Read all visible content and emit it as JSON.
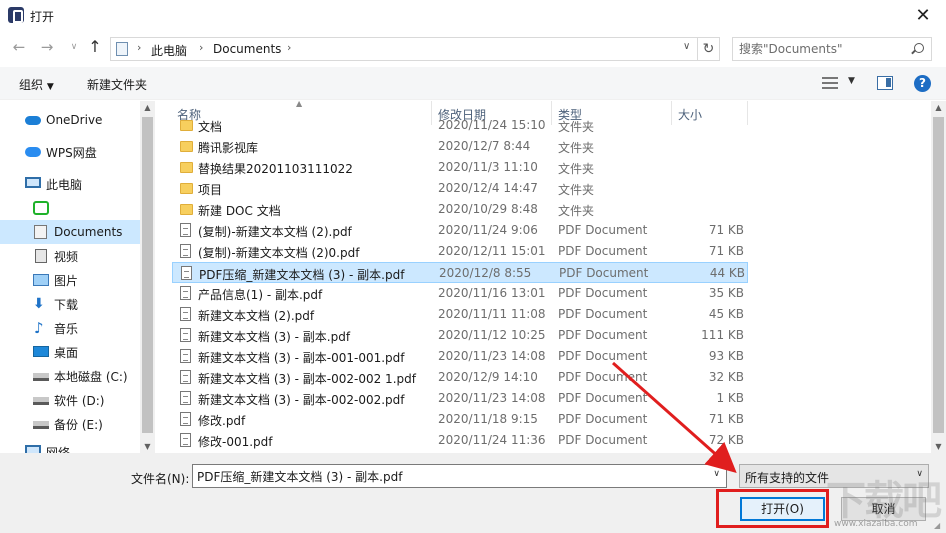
{
  "window": {
    "title": "打开",
    "close_label": "✕"
  },
  "nav": {
    "back_icon": "arrow-left-icon",
    "forward_icon": "arrow-right-icon",
    "up_icon": "arrow-up-icon",
    "address_segments": [
      "此电脑",
      "Documents"
    ],
    "search_placeholder": "搜索\"Documents\""
  },
  "toolbar": {
    "organize_label": "组织",
    "new_folder_label": "新建文件夹"
  },
  "sidebar": {
    "items": [
      {
        "label": "OneDrive",
        "icon": "cloud-icon"
      },
      {
        "label": "WPS网盘",
        "icon": "wps-cloud-icon"
      },
      {
        "label": "此电脑",
        "icon": "computer-icon"
      },
      {
        "label": "",
        "icon": "green-app-icon"
      },
      {
        "label": "Documents",
        "icon": "documents-icon",
        "selected": true
      },
      {
        "label": "视频",
        "icon": "video-icon"
      },
      {
        "label": "图片",
        "icon": "pictures-icon"
      },
      {
        "label": "下载",
        "icon": "download-icon"
      },
      {
        "label": "音乐",
        "icon": "music-icon"
      },
      {
        "label": "桌面",
        "icon": "desktop-icon"
      },
      {
        "label": "本地磁盘 (C:)",
        "icon": "drive-icon"
      },
      {
        "label": "软件 (D:)",
        "icon": "drive-icon"
      },
      {
        "label": "备份 (E:)",
        "icon": "drive-icon"
      },
      {
        "label": "网络",
        "icon": "network-icon"
      }
    ]
  },
  "filelist": {
    "columns": {
      "name": "名称",
      "date": "修改日期",
      "type": "类型",
      "size": "大小"
    },
    "rows": [
      {
        "name": "文档",
        "date": "2020/11/24 15:10",
        "type": "文件夹",
        "size": "",
        "kind": "folder"
      },
      {
        "name": "腾讯影视库",
        "date": "2020/12/7 8:44",
        "type": "文件夹",
        "size": "",
        "kind": "folder"
      },
      {
        "name": "替换结果20201103111022",
        "date": "2020/11/3 11:10",
        "type": "文件夹",
        "size": "",
        "kind": "folder"
      },
      {
        "name": "项目",
        "date": "2020/12/4 14:47",
        "type": "文件夹",
        "size": "",
        "kind": "folder"
      },
      {
        "name": "新建 DOC 文档",
        "date": "2020/10/29 8:48",
        "type": "文件夹",
        "size": "",
        "kind": "folder"
      },
      {
        "name": "(复制)-新建文本文档 (2).pdf",
        "date": "2020/11/24 9:06",
        "type": "PDF Document",
        "size": "71 KB",
        "kind": "file"
      },
      {
        "name": "(复制)-新建文本文档 (2)0.pdf",
        "date": "2020/12/11 15:01",
        "type": "PDF Document",
        "size": "71 KB",
        "kind": "file"
      },
      {
        "name": "PDF压缩_新建文本文档 (3) - 副本.pdf",
        "date": "2020/12/8 8:55",
        "type": "PDF Document",
        "size": "44 KB",
        "kind": "file",
        "selected": true
      },
      {
        "name": "产品信息(1) - 副本.pdf",
        "date": "2020/11/16 13:01",
        "type": "PDF Document",
        "size": "35 KB",
        "kind": "file"
      },
      {
        "name": "新建文本文档 (2).pdf",
        "date": "2020/11/11 11:08",
        "type": "PDF Document",
        "size": "45 KB",
        "kind": "file"
      },
      {
        "name": "新建文本文档 (3) - 副本.pdf",
        "date": "2020/11/12 10:25",
        "type": "PDF Document",
        "size": "111 KB",
        "kind": "file"
      },
      {
        "name": "新建文本文档 (3) - 副本-001-001.pdf",
        "date": "2020/11/23 14:08",
        "type": "PDF Document",
        "size": "93 KB",
        "kind": "file"
      },
      {
        "name": "新建文本文档 (3) - 副本-002-002 1.pdf",
        "date": "2020/12/9 14:10",
        "type": "PDF Document",
        "size": "32 KB",
        "kind": "file"
      },
      {
        "name": "新建文本文档 (3) - 副本-002-002.pdf",
        "date": "2020/11/23 14:08",
        "type": "PDF Document",
        "size": "1 KB",
        "kind": "file"
      },
      {
        "name": "修改.pdf",
        "date": "2020/11/18 9:15",
        "type": "PDF Document",
        "size": "71 KB",
        "kind": "file"
      },
      {
        "name": "修改-001.pdf",
        "date": "2020/11/24 11:36",
        "type": "PDF Document",
        "size": "72 KB",
        "kind": "file"
      }
    ]
  },
  "bottom": {
    "filename_label": "文件名(N):",
    "filename_value": "PDF压缩_新建文本文档 (3) - 副本.pdf",
    "filter_value": "所有支持的文件",
    "open_label": "打开(O)",
    "cancel_label": "取消"
  },
  "watermark": {
    "text": "下载吧",
    "subtext": "www.xiazaiba.com"
  },
  "colors": {
    "accent": "#0078d7",
    "selection": "#cce8ff",
    "annotation": "#e01e1e"
  }
}
